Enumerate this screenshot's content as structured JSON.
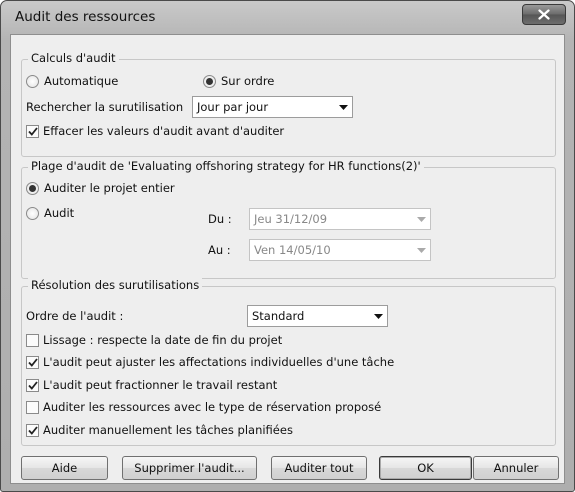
{
  "window": {
    "title": "Audit des ressources"
  },
  "group_calc": {
    "title": "Calculs d'audit",
    "auto_label": "Automatique",
    "manual_label": "Sur ordre",
    "search_label": "Rechercher la surutilisation",
    "search_value": "Jour par jour",
    "clear_label": "Effacer les valeurs d'audit avant d'auditer"
  },
  "group_range": {
    "title": "Plage d'audit de 'Evaluating offshoring strategy for HR functions(2)'",
    "entire_label": "Auditer le projet entier",
    "audit_label": "Audit",
    "from_label": "Du :",
    "from_value": "Jeu 31/12/09",
    "to_label": "Au :",
    "to_value": "Ven 14/05/10"
  },
  "group_resolution": {
    "title": "Résolution des surutilisations",
    "order_label": "Ordre de l'audit :",
    "order_value": "Standard",
    "options": [
      {
        "label": "Lissage : respecte la date de fin du projet",
        "checked": false
      },
      {
        "label": "L'audit peut ajuster les affectations individuelles d'une tâche",
        "checked": true
      },
      {
        "label": "L'audit peut fractionner le travail restant",
        "checked": true
      },
      {
        "label": "Auditer les ressources avec le type de réservation proposé",
        "checked": false
      },
      {
        "label": "Auditer manuellement les tâches planifiées",
        "checked": true
      }
    ]
  },
  "buttons": {
    "help": "Aide",
    "clear": "Supprimer l'audit...",
    "level_all": "Auditer tout",
    "ok": "OK",
    "cancel": "Annuler"
  }
}
